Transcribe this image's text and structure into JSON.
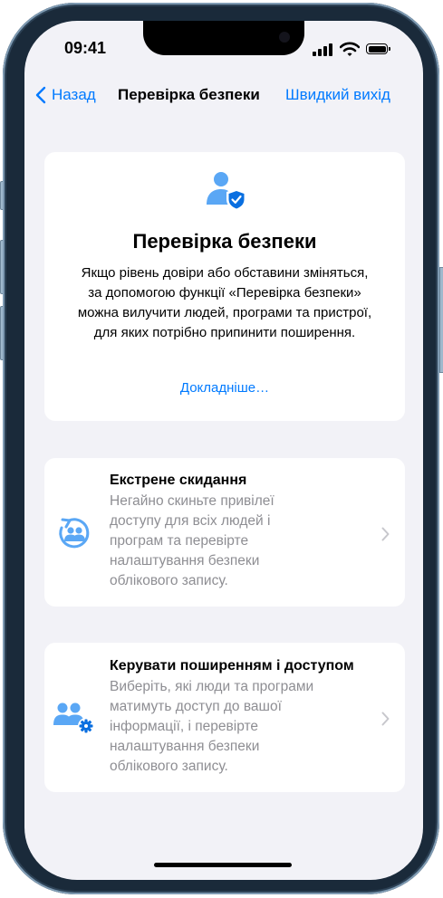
{
  "status": {
    "time": "09:41"
  },
  "nav": {
    "back_label": "Назад",
    "title": "Перевірка безпеки",
    "quick_exit_label": "Швидкий вихід"
  },
  "hero": {
    "icon": "person-shield-icon",
    "title": "Перевірка безпеки",
    "description": "Якщо рівень довіри або обставини зміняться, за допомогою функції «Перевірка безпеки» можна вилучити людей, програми та пристрої, для яких потрібно припинити поширення.",
    "learn_more": "Докладніше…"
  },
  "options": [
    {
      "icon": "emergency-reset-icon",
      "title": "Екстрене скидання",
      "description": "Негайно скиньте привілеї доступу для всіх людей і програм та перевірте налаштування безпеки облікового запису."
    },
    {
      "icon": "people-gear-icon",
      "title": "Керувати поширенням і доступом",
      "description": "Виберіть, які люди та програми матимуть доступ до вашої інформації, і перевірте налаштування безпеки облікового запису."
    }
  ],
  "colors": {
    "accent": "#007aff",
    "icon_blue": "#5aa7f5",
    "background": "#f2f2f7",
    "secondary_text": "#8e8e93"
  }
}
